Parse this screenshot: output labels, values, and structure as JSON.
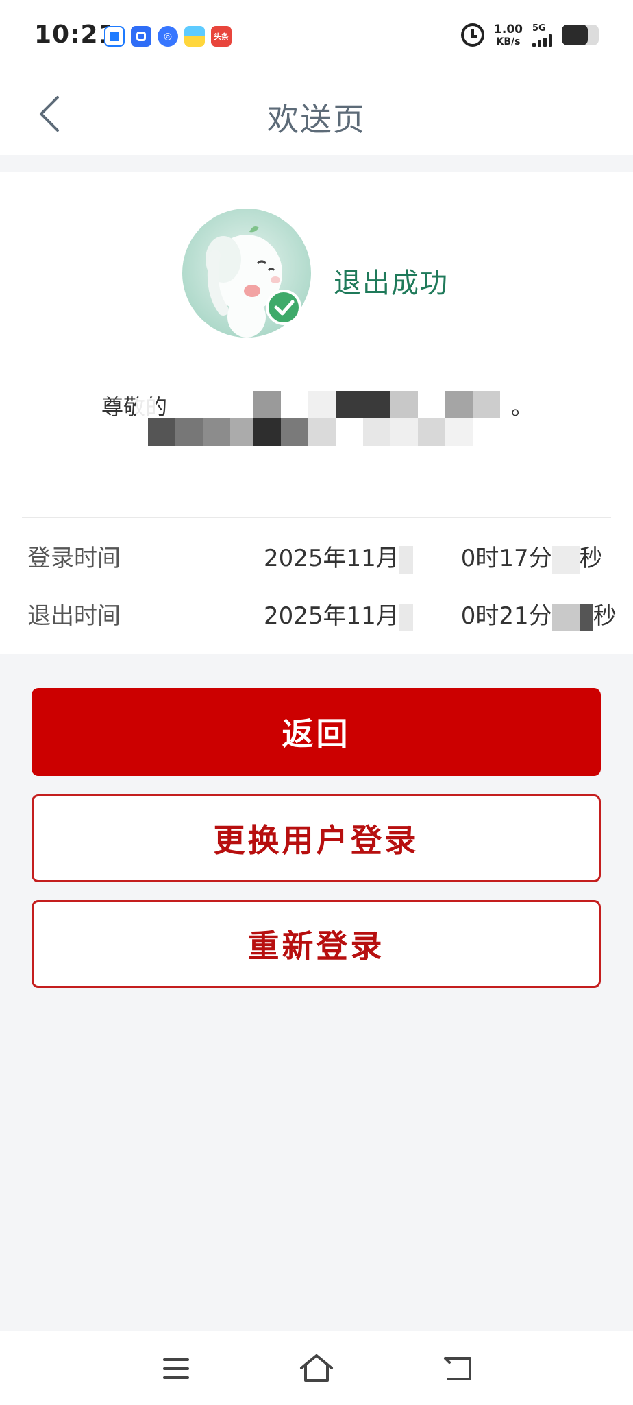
{
  "status_bar": {
    "time": "10:21",
    "app_badge_5": "头条",
    "net_speed_value": "1.00",
    "net_speed_unit": "KB/s",
    "network_type": "5G",
    "battery_level_fraction": 0.7
  },
  "header": {
    "title": "欢送页"
  },
  "result": {
    "status_text": "退出成功",
    "greeting_prefix": "尊敬的",
    "greeting_suffix": "。"
  },
  "session_times": [
    {
      "label": "登录时间",
      "value_prefix": "2025年11月",
      "value_mid": "0时17分",
      "value_suffix": "秒"
    },
    {
      "label": "退出时间",
      "value_prefix": "2025年11月",
      "value_mid": "0时21分",
      "value_suffix": "秒"
    }
  ],
  "actions": {
    "back_label": "返回",
    "switch_user_label": "更换用户登录",
    "relogin_label": "重新登录"
  },
  "colors": {
    "primary_red": "#cc0000",
    "success_green": "#1f7a5a",
    "title_gray": "#5d6b78"
  }
}
